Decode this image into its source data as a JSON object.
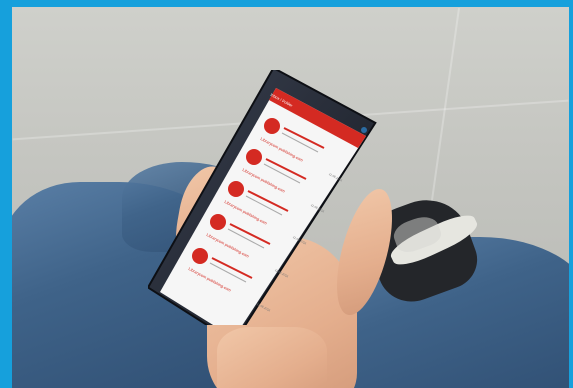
{
  "screen": {
    "app_title": "Inbox / Folder",
    "items": [
      {
        "title": "Librarycom publishing.com",
        "date": "11.08.2016"
      },
      {
        "title": "Librarycom publishing.com",
        "date": "11.08.2016"
      },
      {
        "title": "Librarycom publishing.com",
        "date": "11.08.2016"
      },
      {
        "title": "Librarycom publishing.com",
        "date": "11.08.2016"
      },
      {
        "title": "Librarycom publishing.com",
        "date": "11.08.2016"
      }
    ]
  },
  "colors": {
    "frame": "#16a0dc",
    "accent": "#d42a22",
    "phone": "#1f2430"
  }
}
